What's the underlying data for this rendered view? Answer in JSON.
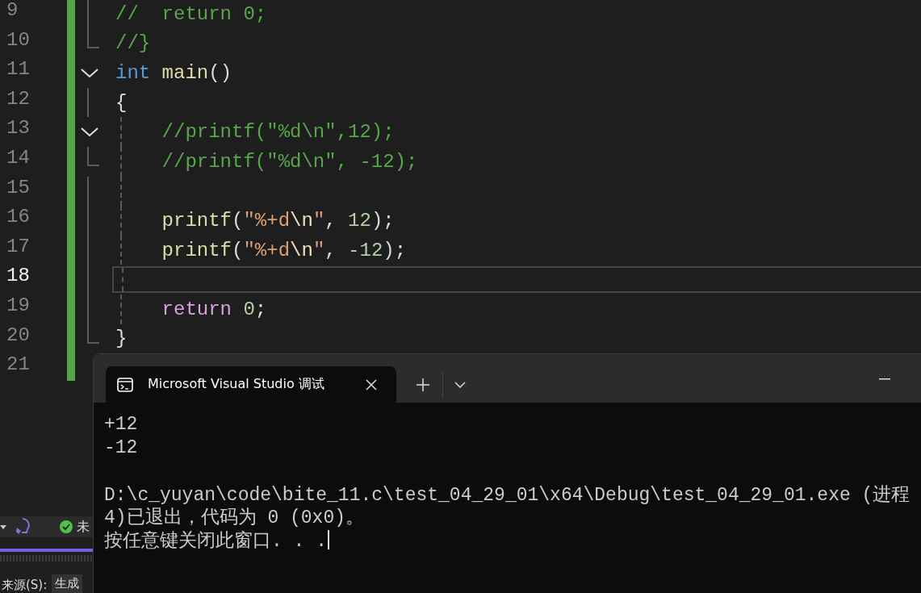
{
  "editor": {
    "lines": [
      {
        "number": "9",
        "current": false,
        "kind": "block",
        "guide": false,
        "tokens": [
          {
            "kind": "comment",
            "text": "//  return 0;"
          }
        ]
      },
      {
        "number": "10",
        "current": false,
        "kind": "block_end",
        "guide": false,
        "tokens": [
          {
            "kind": "comment",
            "text": "//}"
          }
        ]
      },
      {
        "number": "11",
        "current": false,
        "kind": "fold_start",
        "guide": false,
        "tokens": [
          {
            "kind": "keyword",
            "text": "int"
          },
          {
            "kind": "function",
            "text": " main"
          },
          {
            "kind": "plain",
            "text": "()"
          }
        ]
      },
      {
        "number": "12",
        "current": false,
        "kind": "block",
        "guide": false,
        "tokens": [
          {
            "kind": "plain",
            "text": "{"
          }
        ]
      },
      {
        "number": "13",
        "current": false,
        "kind": "fold_start",
        "guide": true,
        "tokens": [
          {
            "kind": "comment",
            "text": "    //printf(\"%d\\n\",12);"
          }
        ]
      },
      {
        "number": "14",
        "current": false,
        "kind": "block_end",
        "guide": true,
        "tokens": [
          {
            "kind": "comment",
            "text": "    //printf(\"%d\\n\", -12);"
          }
        ]
      },
      {
        "number": "15",
        "current": false,
        "kind": "block",
        "guide": true
      },
      {
        "number": "16",
        "current": false,
        "kind": "block",
        "guide": true,
        "tokens": [
          {
            "kind": "function",
            "text": "    printf"
          },
          {
            "kind": "plain",
            "text": "("
          },
          {
            "kind": "string",
            "text": "\""
          },
          {
            "kind": "format",
            "text": "%+d"
          },
          {
            "kind": "escape",
            "text": "\\n"
          },
          {
            "kind": "string",
            "text": "\""
          },
          {
            "kind": "plain",
            "text": ", "
          },
          {
            "kind": "number",
            "text": "12"
          },
          {
            "kind": "plain",
            "text": ");"
          }
        ]
      },
      {
        "number": "17",
        "current": false,
        "kind": "block",
        "guide": true,
        "tokens": [
          {
            "kind": "function",
            "text": "    printf"
          },
          {
            "kind": "plain",
            "text": "("
          },
          {
            "kind": "string",
            "text": "\""
          },
          {
            "kind": "format",
            "text": "%+d"
          },
          {
            "kind": "escape",
            "text": "\\n"
          },
          {
            "kind": "string",
            "text": "\""
          },
          {
            "kind": "plain",
            "text": ", "
          },
          {
            "kind": "number",
            "text": "-12"
          },
          {
            "kind": "plain",
            "text": ");"
          }
        ]
      },
      {
        "number": "18",
        "current": true,
        "kind": "block",
        "guide": true
      },
      {
        "number": "19",
        "current": false,
        "kind": "block",
        "guide": true,
        "tokens": [
          {
            "kind": "control",
            "text": "    return"
          },
          {
            "kind": "number",
            "text": " 0"
          },
          {
            "kind": "plain",
            "text": ";"
          }
        ]
      },
      {
        "number": "20",
        "current": false,
        "kind": "block_end",
        "guide": false,
        "tokens": [
          {
            "kind": "plain",
            "text": "}"
          }
        ]
      },
      {
        "number": "21",
        "current": false,
        "kind": "plain"
      }
    ]
  },
  "bottom_panel": {
    "status_text": "未",
    "source_label": "来源(S):",
    "source_value": "生成"
  },
  "terminal": {
    "tab_title": "Microsoft Visual Studio 调试",
    "output": [
      "+12",
      "-12"
    ],
    "exit_message": [
      "D:\\c_yuyan\\code\\bite_11.c\\test_04_29_01\\x64\\Debug\\test_04_29_01.exe (进程",
      "4)已退出，代码为 0 (0x0)。",
      "按任意键关闭此窗口. . ."
    ]
  }
}
